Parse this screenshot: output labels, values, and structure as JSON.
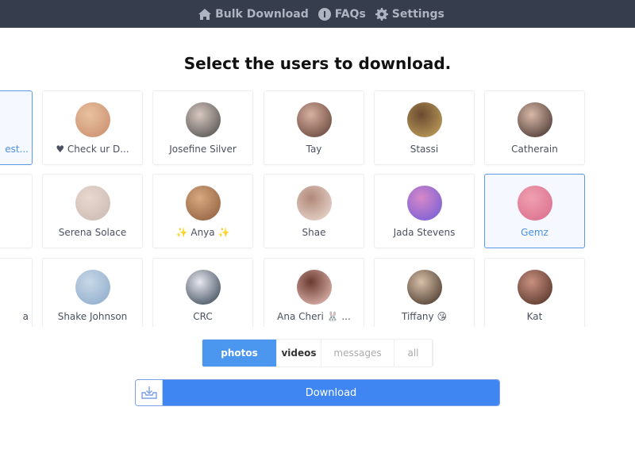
{
  "nav": {
    "items": [
      {
        "label": "Bulk Download",
        "icon": "home-icon"
      },
      {
        "label": "FAQs",
        "icon": "info-icon"
      },
      {
        "label": "Settings",
        "icon": "gear-icon"
      }
    ]
  },
  "title": "Select the users to download.",
  "colors": {
    "accent": "#4b97f0",
    "topbar": "#363d4c",
    "selected_border": "#5b9be8"
  },
  "users": [
    {
      "name": "est...",
      "selected": true,
      "partial": true
    },
    {
      "name": "♥ Check ur D...",
      "selected": false
    },
    {
      "name": "Josefine Silver",
      "selected": false
    },
    {
      "name": "Tay",
      "selected": false
    },
    {
      "name": "Stassi",
      "selected": false
    },
    {
      "name": "Catherain",
      "selected": false
    },
    {
      "name": "",
      "selected": false,
      "partial": true
    },
    {
      "name": "Serena Solace",
      "selected": false
    },
    {
      "name": "✨ Anya ✨",
      "selected": false
    },
    {
      "name": "Shae",
      "selected": false
    },
    {
      "name": "Jada Stevens",
      "selected": false
    },
    {
      "name": "Gemz",
      "selected": true
    },
    {
      "name": "a",
      "selected": false,
      "partial": true
    },
    {
      "name": "Shake Johnson",
      "selected": false
    },
    {
      "name": "CRC",
      "selected": false
    },
    {
      "name": "Ana Cheri 🐰 ...",
      "selected": false
    },
    {
      "name": "Tiffany 😘",
      "selected": false
    },
    {
      "name": "Kat",
      "selected": false
    }
  ],
  "media_tabs": [
    {
      "label": "photos",
      "active": true
    },
    {
      "label": "videos",
      "active": false
    },
    {
      "label": "messages",
      "active": false
    },
    {
      "label": "all",
      "active": false
    }
  ],
  "download": {
    "label": "Download",
    "icon": "download-tray-icon"
  }
}
